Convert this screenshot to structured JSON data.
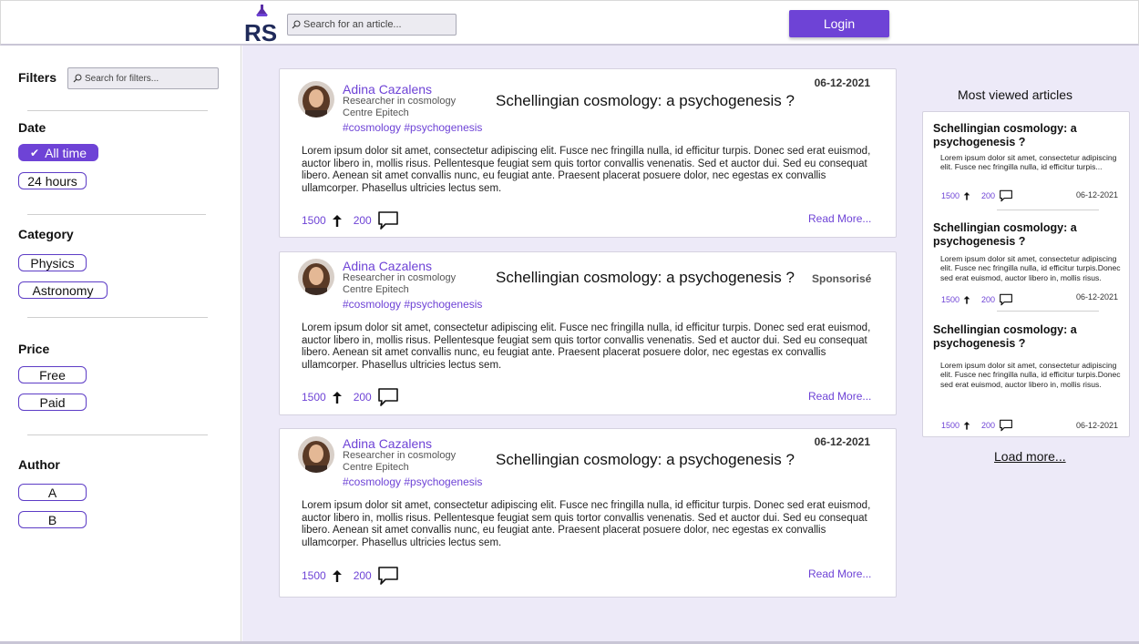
{
  "header": {
    "logo_text": "RS",
    "search_placeholder": "Search for an article...",
    "login_label": "Login"
  },
  "sidebar": {
    "filters_title": "Filters",
    "filter_search_placeholder": "Search for filters...",
    "sections": {
      "date": {
        "title": "Date",
        "options": [
          "All time",
          "24 hours"
        ],
        "selected": "All time"
      },
      "category": {
        "title": "Category",
        "options": [
          "Physics",
          "Astronomy"
        ]
      },
      "price": {
        "title": "Price",
        "options": [
          "Free",
          "Paid"
        ]
      },
      "author": {
        "title": "Author",
        "options": [
          "A",
          "B"
        ]
      }
    }
  },
  "articles": [
    {
      "author": "Adina Cazalens",
      "role": "Researcher in cosmology",
      "org": "Centre Epitech",
      "tags": "#cosmology #psychogenesis",
      "title": "Schellingian cosmology: a psychogenesis ?",
      "date": "06-12-2021",
      "sponsored": "",
      "body": "Lorem ipsum dolor sit amet, consectetur adipiscing elit. Fusce nec fringilla nulla, id efficitur turpis. Donec sed erat euismod, auctor libero in, mollis risus. Pellentesque feugiat sem quis tortor convallis venenatis. Sed et auctor dui. Sed eu consequat libero. Aenean sit amet convallis nunc, eu feugiat ante. Praesent placerat posuere dolor, nec egestas ex convallis ullamcorper. Phasellus ultricies lectus sem.",
      "upvotes": "1500",
      "comments": "200",
      "read_more": "Read More..."
    },
    {
      "author": "Adina Cazalens",
      "role": "Researcher in cosmology",
      "org": "Centre Epitech",
      "tags": "#cosmology #psychogenesis",
      "title": "Schellingian cosmology: a psychogenesis ?",
      "date": "",
      "sponsored": "Sponsorisé",
      "body": "Lorem ipsum dolor sit amet, consectetur adipiscing elit. Fusce nec fringilla nulla, id efficitur turpis. Donec sed erat euismod, auctor libero in, mollis risus. Pellentesque feugiat sem quis tortor convallis venenatis. Sed et auctor dui. Sed eu consequat libero. Aenean sit amet convallis nunc, eu feugiat ante. Praesent placerat posuere dolor, nec egestas ex convallis ullamcorper. Phasellus ultricies lectus sem.",
      "upvotes": "1500",
      "comments": "200",
      "read_more": "Read More..."
    },
    {
      "author": "Adina Cazalens",
      "role": "Researcher in cosmology",
      "org": "Centre Epitech",
      "tags": "#cosmology #psychogenesis",
      "title": "Schellingian cosmology: a psychogenesis ?",
      "date": "06-12-2021",
      "sponsored": "",
      "body": "Lorem ipsum dolor sit amet, consectetur adipiscing elit. Fusce nec fringilla nulla, id efficitur turpis. Donec sed erat euismod, auctor libero in, mollis risus. Pellentesque feugiat sem quis tortor convallis venenatis. Sed et auctor dui. Sed eu consequat libero. Aenean sit amet convallis nunc, eu feugiat ante. Praesent placerat posuere dolor, nec egestas ex convallis ullamcorper. Phasellus ultricies lectus sem.",
      "upvotes": "1500",
      "comments": "200",
      "read_more": "Read More..."
    }
  ],
  "most_viewed": {
    "title": "Most viewed articles",
    "items": [
      {
        "title": "Schellingian cosmology: a psychogenesis ?",
        "body": "Lorem ipsum dolor sit amet, consectetur adipiscing elit. Fusce nec fringilla nulla, id efficitur turpis...",
        "upvotes": "1500",
        "comments": "200",
        "date": "06-12-2021"
      },
      {
        "title": "Schellingian cosmology: a psychogenesis ?",
        "body": "Lorem ipsum dolor sit amet, consectetur adipiscing elit. Fusce nec fringilla nulla, id efficitur turpis.Donec sed erat euismod, auctor libero in, mollis risus.",
        "upvotes": "1500",
        "comments": "200",
        "date": "06-12-2021"
      },
      {
        "title": "Schellingian cosmology: a psychogenesis ?",
        "body": "Lorem ipsum dolor sit amet, consectetur adipiscing elit. Fusce nec fringilla nulla, id efficitur turpis.Donec sed erat euismod, auctor libero in, mollis risus.",
        "upvotes": "1500",
        "comments": "200",
        "date": "06-12-2021"
      }
    ],
    "load_more": "Load more..."
  },
  "colors": {
    "accent": "#6e43d6",
    "main_background": "#edeaf8",
    "input_background": "#ecebf1"
  }
}
